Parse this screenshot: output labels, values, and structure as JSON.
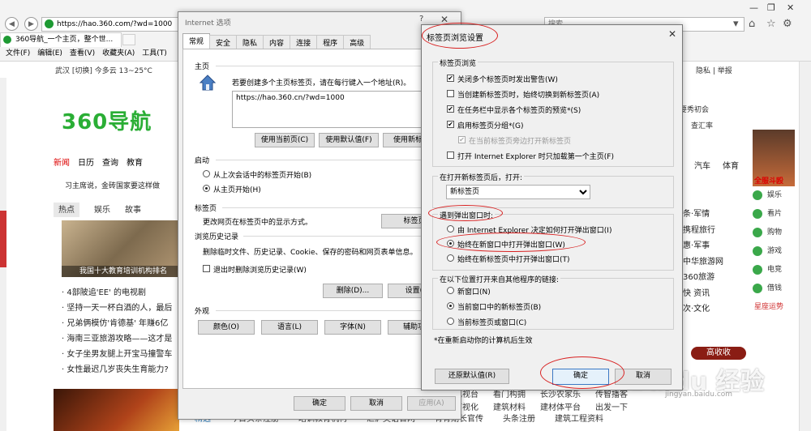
{
  "browser": {
    "address": "https://hao.360.com/?wd=1000",
    "search_placeholder": "搜索...",
    "tab_title": "360导航_一个主页，整个世...",
    "menu": [
      "文件(F)",
      "编辑(E)",
      "查看(V)",
      "收藏夹(A)",
      "工具(T)"
    ]
  },
  "page": {
    "infobar": "武汉 [切换]   今多云 13~25°C",
    "logo": "360导航",
    "news_nav": [
      "新闻",
      "日历",
      "查询",
      "教育"
    ],
    "headline": "习主席说，金砖国家要这样做",
    "subtabs": [
      "热点",
      "娱乐",
      "故事"
    ],
    "photo_caption": "我国十大教育培训机构排名",
    "news_items": [
      "4部陂追'EE' 的电视剧",
      "坚持一天一杯白酒的人，最后",
      "兄弟俩模仿'肯德基' 年赚6亿",
      "海南三亚旅游攻略——这才是",
      "女子坐男友腿上开宝马撞警车",
      "女性最迟几岁丧失生育能力?"
    ],
    "top_right_links": "隐私 | 举报",
    "right_small": [
      "要秀初会",
      "查汇率"
    ],
    "right_nav": [
      "汽车",
      "体育"
    ],
    "right_links": [
      "条·军情",
      "携程旅行",
      "惠·军事",
      "中华旅游网",
      "360旅游",
      "快 资讯",
      "次·文化"
    ],
    "right_sidebar": [
      "娱乐",
      "看片",
      "购物",
      "游戏",
      "电竞",
      "借钱",
      "星座运势"
    ],
    "hero_label": "全服斗殴",
    "gaoshou": "高收收",
    "bottom_row": [
      "精选",
      "今日头条注册",
      "培训教育机构",
      "汇沪英语官网",
      "青青期长官传",
      "头条注册",
      "建筑工程资料"
    ],
    "bottom_row2": [
      "网络电视台",
      "看门构拥",
      "长沙农家乐",
      "传智播客",
      "看看可视化",
      "建筑材料",
      "建材体平台",
      "出发一下"
    ],
    "watermark": "Baidu 经验",
    "watermark_sub": "jingyan.baidu.com"
  },
  "internet_options": {
    "title": "Internet 选项",
    "help": "?",
    "tabs": [
      "常规",
      "安全",
      "隐私",
      "内容",
      "连接",
      "程序",
      "高级"
    ],
    "home_label": "主页",
    "home_desc": "若要创建多个主页标签页，请在每行键入一个地址(R)。",
    "home_url": "https://hao.360.cn/?wd=1000",
    "btn_current": "使用当前页(C)",
    "btn_default": "使用默认值(F)",
    "btn_newtab": "使用新标签页",
    "startup_label": "启动",
    "startup_opt1": "从上次会话中的标签页开始(B)",
    "startup_opt2": "从主页开始(H)",
    "tabs_label": "标签页",
    "tabs_desc": "更改网页在标签页中的显示方式。",
    "tabs_btn": "标签页",
    "history_label": "浏览历史记录",
    "history_desc": "删除临时文件、历史记录、Cookie、保存的密码和网页表单信息。",
    "history_chk": "退出时删除浏览历史记录(W)",
    "btn_delete": "删除(D)...",
    "btn_settings": "设置(S)",
    "appearance_label": "外观",
    "btn_colors": "颜色(O)",
    "btn_lang": "语言(L)",
    "btn_fonts": "字体(N)",
    "btn_access": "辅助功能",
    "btn_ok": "确定",
    "btn_cancel": "取消",
    "btn_apply": "应用(A)"
  },
  "tab_settings": {
    "title": "标签页浏览设置",
    "grp_browsing": "标签页浏览",
    "checkboxes": [
      {
        "label": "关闭多个标签页时发出警告(W)",
        "checked": true
      },
      {
        "label": "当创建新标签页时，始终切换到新标签页(A)",
        "checked": false
      },
      {
        "label": "在任务栏中显示各个标签页的预览*(S)",
        "checked": true
      },
      {
        "label": "启用标签页分组*(G)",
        "checked": true
      },
      {
        "label": "在当前标签页旁边打开新标签页",
        "checked": true,
        "disabled": true
      },
      {
        "label": "打开 Internet Explorer 时只加载第一个主页(F)",
        "checked": false
      }
    ],
    "open_newtab_label": "在打开新标签页后，打开:",
    "open_newtab_value": "新标签页",
    "popup_label": "遇到弹出窗口时:",
    "popup_options": [
      {
        "label": "由 Internet Explorer 决定如何打开弹出窗口(I)",
        "selected": false
      },
      {
        "label": "始终在新窗口中打开弹出窗口(W)",
        "selected": true
      },
      {
        "label": "始终在新标签页中打开弹出窗口(T)",
        "selected": false
      }
    ],
    "links_label": "在以下位置打开来自其他程序的链接:",
    "links_options": [
      {
        "label": "新窗口(N)",
        "selected": false
      },
      {
        "label": "当前窗口中的新标签页(B)",
        "selected": true
      },
      {
        "label": "当前标签页或窗口(C)",
        "selected": false
      }
    ],
    "note": "*在重新启动你的计算机后生效",
    "btn_restore": "还原默认值(R)",
    "btn_ok": "确定",
    "btn_cancel": "取消"
  }
}
